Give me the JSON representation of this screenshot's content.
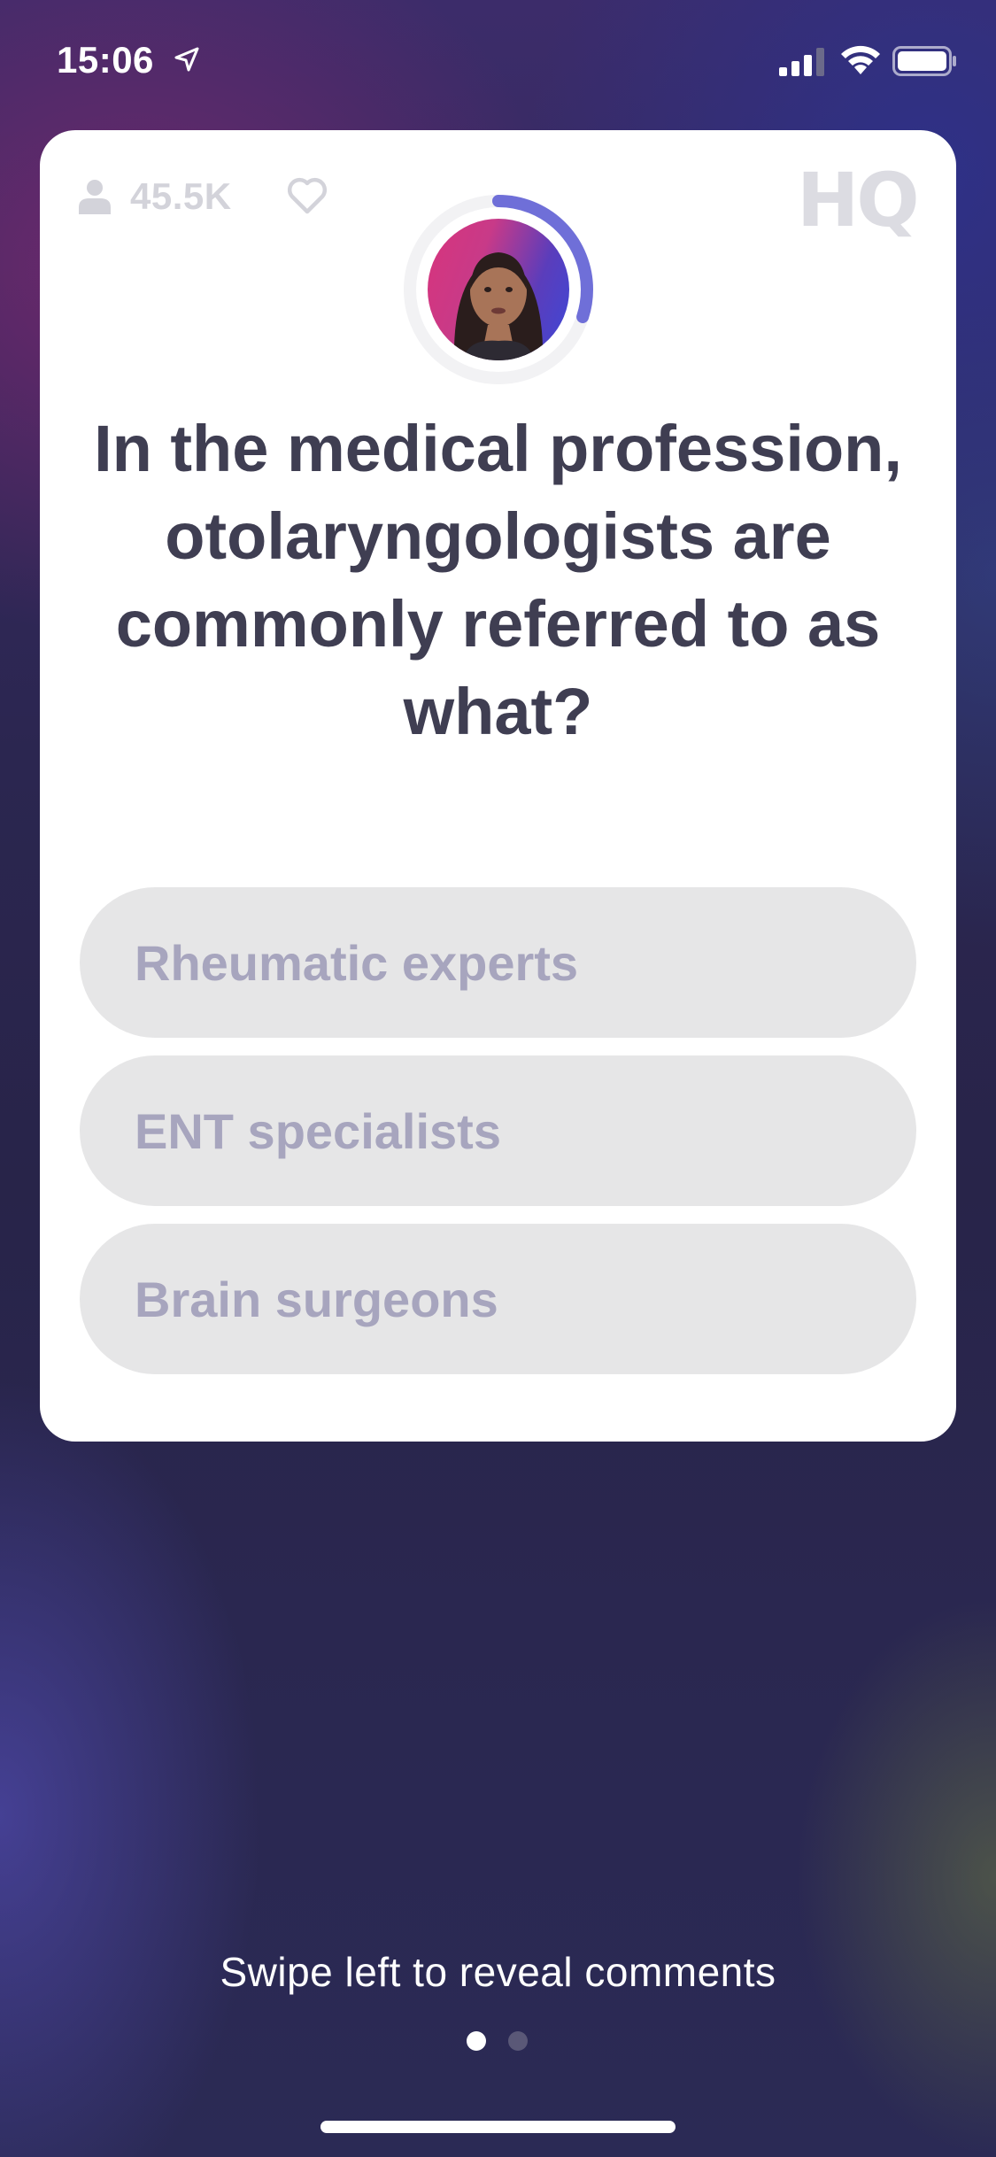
{
  "status_bar": {
    "time": "15:06",
    "icons": [
      "location-arrow-icon",
      "signal-icon",
      "wifi-icon",
      "battery-icon"
    ]
  },
  "card": {
    "viewer_count": "45.5K",
    "logo_text": "HQ",
    "question": "In the medical profession, otolaryngologists are commonly referred to as what?",
    "answers": [
      {
        "label": "Rheumatic experts"
      },
      {
        "label": "ENT specialists"
      },
      {
        "label": "Brain surgeons"
      }
    ],
    "timer_progress": 0.3
  },
  "footer": {
    "swipe_hint": "Swipe left to reveal comments",
    "page_count": 2,
    "active_page": 1
  },
  "colors": {
    "question_text": "#3f3e52",
    "answer_bg": "#e6e6e7",
    "answer_text": "#a7a5be",
    "timer_ring": "#6f6fd8"
  }
}
